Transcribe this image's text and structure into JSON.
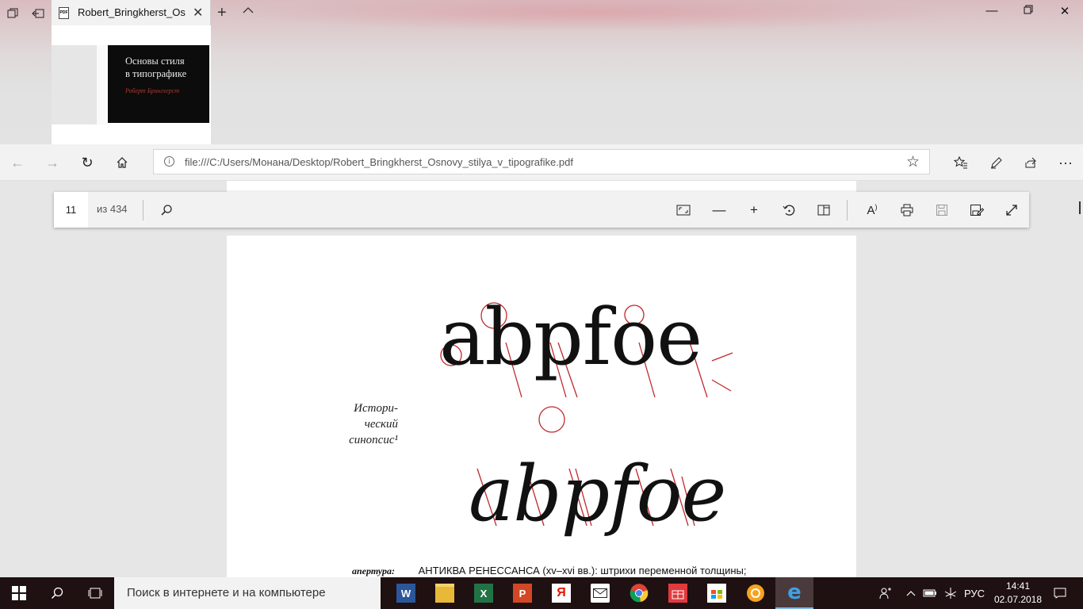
{
  "tab": {
    "title": "Robert_Bringkherst_Osr",
    "preview_title_line1": "Основы стиля",
    "preview_title_line2": "в типографике",
    "preview_author": "Роберт Брингхерст"
  },
  "address": {
    "url": "file:///C:/Users/Монана/Desktop/Robert_Bringkherst_Osnovy_stilya_v_tipografike.pdf"
  },
  "pdf_toolbar": {
    "current_page": "11",
    "total_pages": "из 434"
  },
  "page": {
    "glyphs_roman": "abpfoe",
    "glyphs_italic": "abpfoe",
    "side_note_line1": "Истори-",
    "side_note_line2": "ческий",
    "side_note_line3": "синопсис¹",
    "caption_label": "апертура:",
    "caption_text": "АНТИКВА РЕНЕССАНСА (xv–xvi вв.): штрихи переменной толщины;"
  },
  "taskbar": {
    "search_placeholder": "Поиск в интернете и на компьютере",
    "lang": "РУС",
    "time": "14:41",
    "date": "02.07.2018"
  },
  "colors": {
    "accent": "#7fb7e8",
    "annotation_red": "#c0282d",
    "taskbar_bg": "#1f1012"
  },
  "icons": [
    "tab-manager-icon",
    "set-aside-icon",
    "pdf-icon",
    "close-icon",
    "new-tab-icon",
    "chevron-up-icon",
    "minimize-icon",
    "restore-icon",
    "back-icon",
    "forward-icon",
    "refresh-icon",
    "home-icon",
    "info-icon",
    "star-icon",
    "favorites-icon",
    "pen-icon",
    "share-icon",
    "more-icon",
    "search-icon",
    "fit-page-icon",
    "zoom-out-icon",
    "zoom-in-icon",
    "rotate-icon",
    "layout-icon",
    "read-aloud-icon",
    "print-icon",
    "save-icon",
    "save-as-icon",
    "fullscreen-icon",
    "windows-icon",
    "task-view-icon",
    "people-icon",
    "network-icon",
    "volume-icon",
    "notification-icon"
  ]
}
